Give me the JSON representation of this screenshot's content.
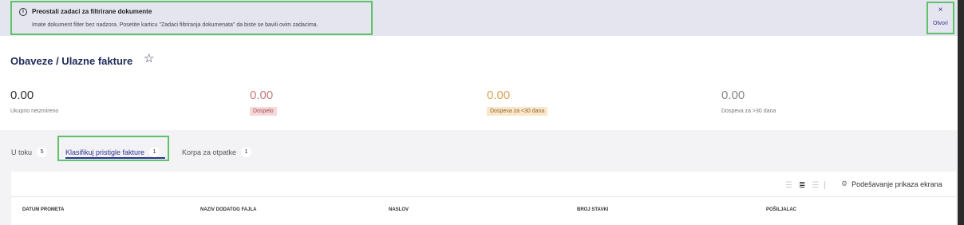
{
  "banner": {
    "title": "Preostali zadaci za filtrirane dokumente",
    "text": "Imate dokument filter bez nadzora. Posetite karticu \"Zadaci filtriranja dokumenata\" da biste se bavili ovim zadacima.",
    "info_icon": "info-icon",
    "close_label": "×",
    "open_label": "Otvori"
  },
  "page": {
    "title": "Obaveze / Ulazne fakture",
    "star_icon": "☆"
  },
  "stats": [
    {
      "value": "0.00",
      "label": "Ukupno neizmireno",
      "color": "#333333"
    },
    {
      "value": "0.00",
      "label": "Dospelo",
      "color": "#c8797d"
    },
    {
      "value": "0.00",
      "label": "Dospeva za <30 dana",
      "color": "#d8a35a"
    },
    {
      "value": "0.00",
      "label": "Dospeva za >30 dana",
      "color": "#888888"
    }
  ],
  "tabs": [
    {
      "label": "U toku",
      "count": "5",
      "active": false
    },
    {
      "label": "Klasifikuj pristigle fakture",
      "count": "1",
      "active": true
    },
    {
      "label": "Korpa za otpatke",
      "count": "1",
      "active": false
    }
  ],
  "toolbar": {
    "view_icons": [
      "grid-view-icon",
      "list-view-icon",
      "compact-view-icon"
    ],
    "settings_label": "Podešavanje prikaza ekrana",
    "settings_icon": "gear-icon"
  },
  "table": {
    "columns": [
      "DATUM PROMETA",
      "NAZIV DODATOG FAJLA",
      "NASLOV",
      "BROJ STAVKI",
      "POŠILJALAC"
    ]
  }
}
